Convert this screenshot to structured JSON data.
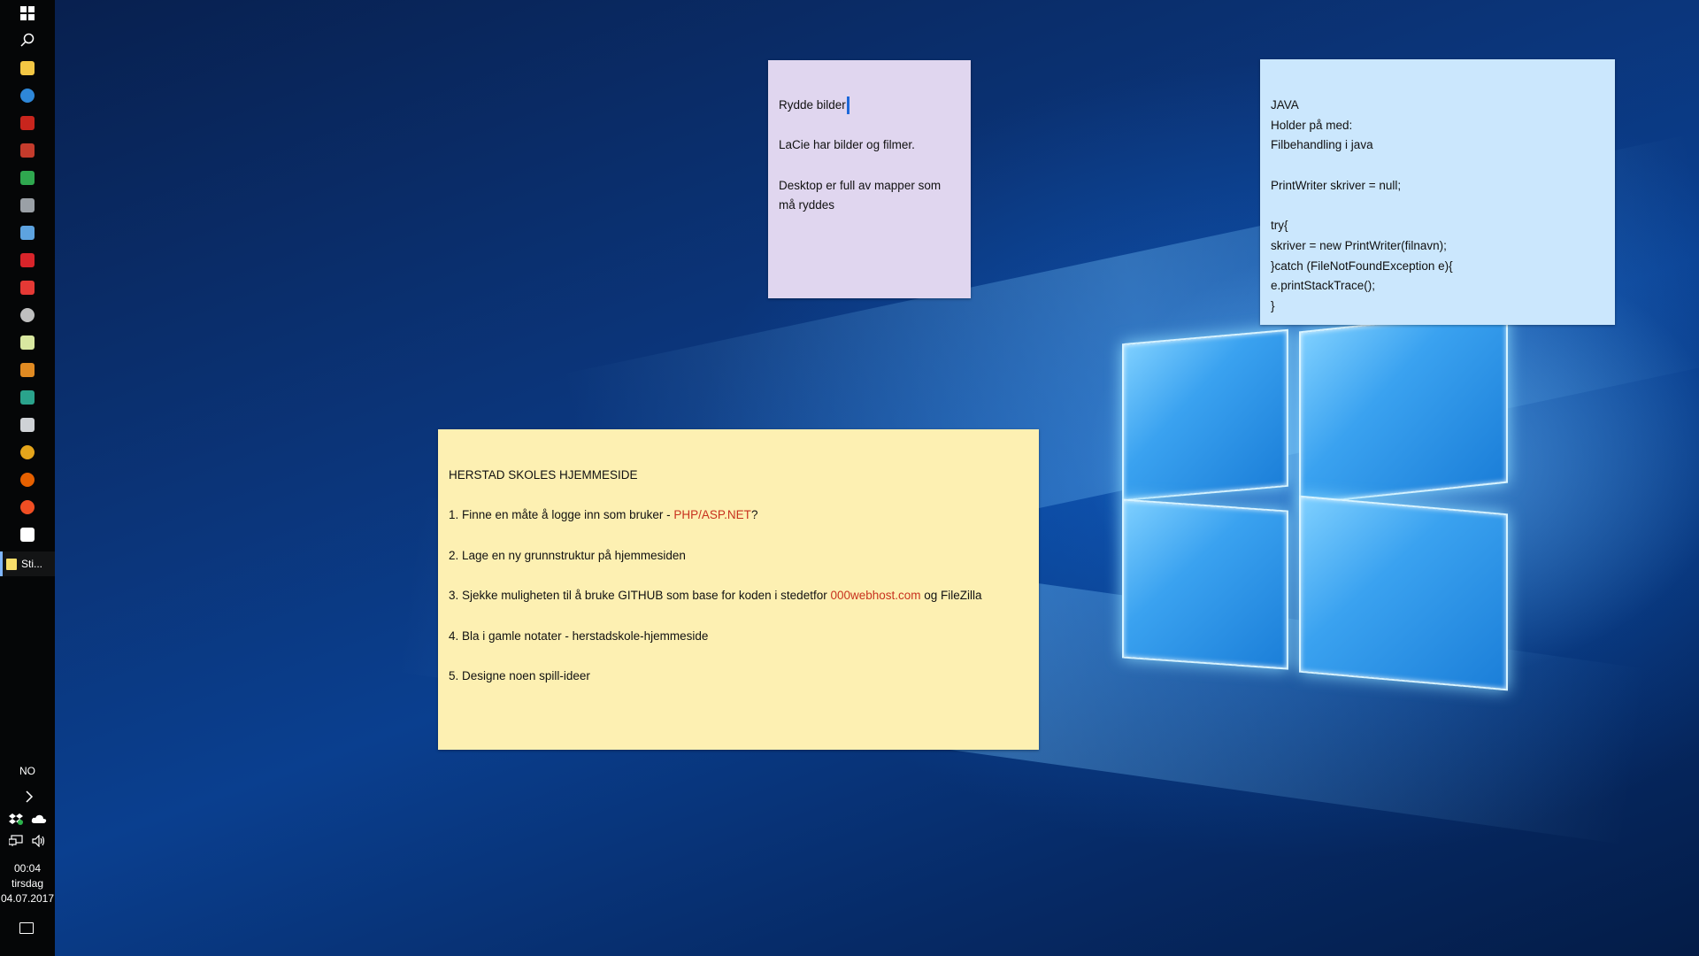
{
  "taskbar": {
    "pinned": [
      {
        "name": "start-button",
        "icon": "windows-logo-icon",
        "color": "#ffffff"
      },
      {
        "name": "search-button",
        "icon": "search-icon",
        "color": "#ffffff"
      },
      {
        "name": "file-explorer",
        "icon": "folder-icon",
        "color": "#f3c744"
      },
      {
        "name": "thunderbird",
        "icon": "thunderbird-icon",
        "color": "#2e87d8"
      },
      {
        "name": "filezilla",
        "icon": "filezilla-icon",
        "color": "#c8251d"
      },
      {
        "name": "git-app",
        "icon": "git-icon",
        "color": "#c43b2c"
      },
      {
        "name": "app-green",
        "icon": "green-app-icon",
        "color": "#2fa84f"
      },
      {
        "name": "terminal",
        "icon": "terminal-icon",
        "color": "#9aa0a6"
      },
      {
        "name": "paint",
        "icon": "paint-icon",
        "color": "#5da3e0"
      },
      {
        "name": "media-player",
        "icon": "play-icon",
        "color": "#d8242a"
      },
      {
        "name": "app-red",
        "icon": "red-app-icon",
        "color": "#e53935"
      },
      {
        "name": "app-zz",
        "icon": "circle-app-icon",
        "color": "#bfbfbf"
      },
      {
        "name": "notepad",
        "icon": "notepad-icon",
        "color": "#d9e8a0"
      },
      {
        "name": "app-orange",
        "icon": "orange-app-icon",
        "color": "#e08a22"
      },
      {
        "name": "app-teal",
        "icon": "teal-app-icon",
        "color": "#2aa38c"
      },
      {
        "name": "app-gray",
        "icon": "gray-app-icon",
        "color": "#cfd2d6"
      },
      {
        "name": "chrome",
        "icon": "chrome-icon",
        "color": "#e5a51b"
      },
      {
        "name": "firefox",
        "icon": "firefox-icon",
        "color": "#e66000"
      },
      {
        "name": "app-fox",
        "icon": "orange-circle-icon",
        "color": "#f04e23"
      },
      {
        "name": "mail",
        "icon": "mail-icon",
        "color": "#ffffff"
      }
    ],
    "running_app_label": "Sti...",
    "language": "NO",
    "clock_time": "00:04",
    "clock_day": "tirsdag",
    "clock_date": "04.07.2017"
  },
  "notes": {
    "purple": {
      "lines": [
        "Rydde bilder",
        "",
        "LaCie har bilder og filmer.",
        "",
        "Desktop er full av mapper som",
        "må ryddes"
      ]
    },
    "blue": {
      "lines": [
        "JAVA",
        "Holder på med:",
        "Filbehandling i java",
        "",
        "PrintWriter skriver = null;",
        "",
        "try{",
        "skriver = new PrintWriter(filnavn);",
        "}catch (FileNotFoundException e){",
        "e.printStackTrace();",
        "}"
      ]
    },
    "yellow": {
      "title": "HERSTAD SKOLES HJEMMESIDE",
      "item1_pre": "1. Finne en måte å logge inn som bruker - ",
      "item1_link": "PHP/ASP.NET",
      "item1_post": "?",
      "item2": "2. Lage en ny grunnstruktur på hjemmesiden",
      "item3_pre": "3. Sjekke muligheten til å bruke GITHUB som base for koden i stedetfor ",
      "item3_link": "000webhost.com",
      "item3_post": " og FileZilla",
      "item4": "4. Bla i gamle notater - herstadskole-hjemmeside",
      "item5": "5. Designe noen spill-ideer"
    }
  }
}
